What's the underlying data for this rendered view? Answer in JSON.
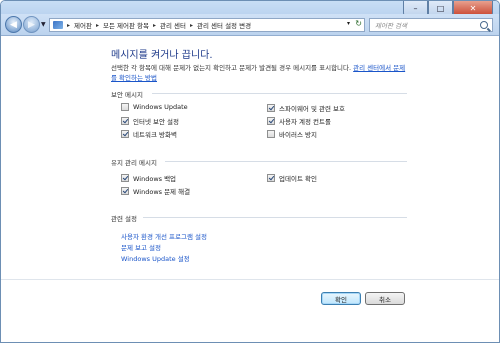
{
  "window": {
    "titlebar": {
      "minimize": "–",
      "maximize": "□",
      "close": "✕"
    }
  },
  "navbar": {
    "breadcrumbs": [
      "제어판",
      "모든 제어판 항목",
      "관리 센터",
      "관리 센터 설정 변경"
    ],
    "search_placeholder": "제어판 검색"
  },
  "main": {
    "title": "메시지를 켜거나 끕니다.",
    "description": "선택한 각 항목에 대해 문제가 없는지 확인하고 문제가 발견될 경우 메시지를 표시합니다.",
    "description_link": "관리 센터에서 문제를 확인하는 방법",
    "security": {
      "heading": "보안 메시지",
      "items": [
        {
          "label": "Windows Update",
          "checked": false
        },
        {
          "label": "스파이웨어 및 관련 보호",
          "checked": true
        },
        {
          "label": "인터넷 보안 설정",
          "checked": true
        },
        {
          "label": "사용자 계정 컨트롤",
          "checked": true
        },
        {
          "label": "네트워크 방화벽",
          "checked": true
        },
        {
          "label": "바이러스 방지",
          "checked": false
        }
      ]
    },
    "maintenance": {
      "heading": "유지 관리 메시지",
      "items": [
        {
          "label": "Windows 백업",
          "checked": true
        },
        {
          "label": "업데이트 확인",
          "checked": true
        },
        {
          "label": "Windows 문제 해결",
          "checked": true
        }
      ]
    },
    "related": {
      "heading": "관련 설정",
      "links": [
        "사용자 환경 개선 프로그램 설정",
        "문제 보고 설정",
        "Windows Update 설정"
      ]
    }
  },
  "buttons": {
    "ok": "확인",
    "cancel": "취소"
  }
}
